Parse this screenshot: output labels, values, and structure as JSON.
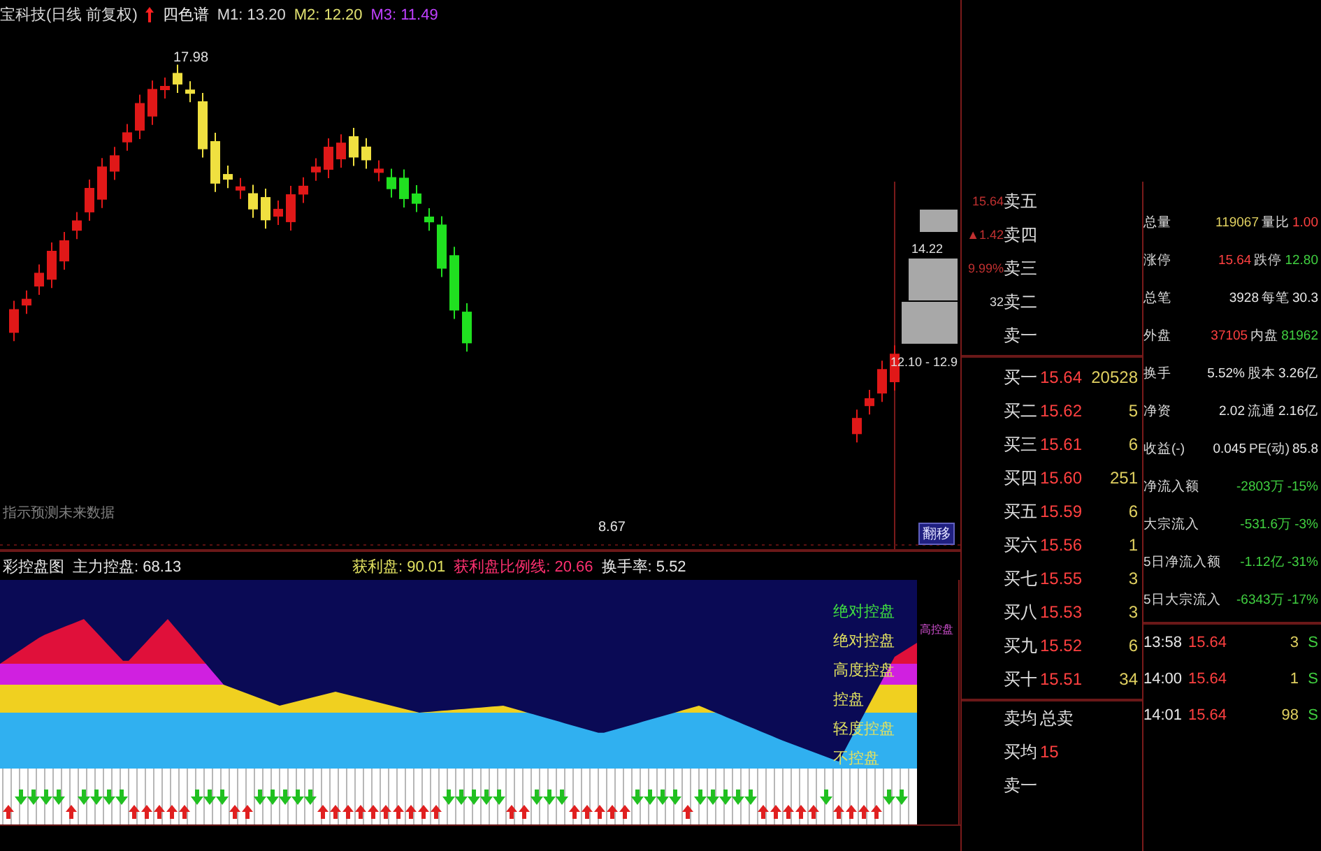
{
  "chart": {
    "title": "宝科技(日线 前复权)",
    "indicator": "四色谱",
    "ma": [
      {
        "label": "M1: 13.20",
        "color": "#d8d8d8"
      },
      {
        "label": "M2: 12.20",
        "color": "#e0e070"
      },
      {
        "label": "M3: 11.49",
        "color": "#c040ff"
      }
    ],
    "high_label": "17.98",
    "low_label": "8.67",
    "box_labels": [
      "14.22",
      "12.10 - 12.9"
    ],
    "note": "指示预测未来数据",
    "shift_button": "翻移"
  },
  "indicator": {
    "name": "彩控盘图",
    "fields_left": [
      {
        "label": "主力控盘: 68.13",
        "color": "#e8e8e8"
      }
    ],
    "fields_right": [
      {
        "label": "获利盘: 90.01",
        "color": "#e0e060"
      },
      {
        "label": "获利盘比例线: 20.66",
        "color": "#ff3070"
      },
      {
        "label": "换手率: 5.52",
        "color": "#e8e8e8"
      }
    ],
    "levels": [
      {
        "text": "绝对控盘",
        "color": "#40e040"
      },
      {
        "text": "绝对控盘",
        "color": "#e0e060"
      },
      {
        "text": "高度控盘",
        "color": "#e0e060"
      },
      {
        "text": "控盘",
        "color": "#e0e060"
      },
      {
        "text": "轻度控盘",
        "color": "#e0e060"
      },
      {
        "text": "不控盘",
        "color": "#e0e060"
      }
    ],
    "tag": "高控盘"
  },
  "order_book": {
    "sell": [
      {
        "label": "卖五",
        "axis": {
          "text": "15.64",
          "color": "#c03030"
        }
      },
      {
        "label": "卖四",
        "axis": {
          "text": "▲1.42",
          "color": "#c03030"
        }
      },
      {
        "label": "卖三",
        "axis": {
          "text": "9.99%",
          "color": "#c03030"
        }
      },
      {
        "label": "卖二",
        "axis": {
          "text": "32",
          "color": "#d8d8d8"
        }
      },
      {
        "label": "卖一"
      }
    ],
    "buy": [
      {
        "label": "买一",
        "price": "15.64",
        "volume": "20528"
      },
      {
        "label": "买二",
        "price": "15.62",
        "volume": "5"
      },
      {
        "label": "买三",
        "price": "15.61",
        "volume": "6"
      },
      {
        "label": "买四",
        "price": "15.60",
        "volume": "251"
      },
      {
        "label": "买五",
        "price": "15.59",
        "volume": "6"
      },
      {
        "label": "买六",
        "price": "15.56",
        "volume": "1"
      },
      {
        "label": "买七",
        "price": "15.55",
        "volume": "3"
      },
      {
        "label": "买八",
        "price": "15.53",
        "volume": "3"
      },
      {
        "label": "买九",
        "price": "15.52",
        "volume": "6"
      },
      {
        "label": "买十",
        "price": "15.51",
        "volume": "34"
      }
    ],
    "footer": [
      {
        "label": "卖均",
        "value": "总卖"
      },
      {
        "label": "买均",
        "value": "15"
      },
      {
        "label": "卖一"
      }
    ]
  },
  "stats": [
    [
      {
        "text": "总量",
        "color": "#d8d8d8"
      },
      {
        "text": "119067",
        "color": "#e0d060"
      },
      {
        "text": "量比",
        "color": "#d8d8d8"
      },
      {
        "text": "1.00",
        "color": "#ff4040"
      }
    ],
    [
      {
        "text": "涨停",
        "color": "#d8d8d8"
      },
      {
        "text": "15.64",
        "color": "#ff4040"
      },
      {
        "text": "跌停",
        "color": "#d8d8d8"
      },
      {
        "text": "12.80",
        "color": "#40d040"
      }
    ],
    [
      {
        "text": "总笔",
        "color": "#d8d8d8"
      },
      {
        "text": "3928",
        "color": "#e8e8e8"
      },
      {
        "text": "每笔",
        "color": "#d8d8d8"
      },
      {
        "text": "30.3",
        "color": "#e8e8e8"
      }
    ],
    [
      {
        "text": "外盘",
        "color": "#d8d8d8"
      },
      {
        "text": "37105",
        "color": "#ff4040"
      },
      {
        "text": "内盘",
        "color": "#d8d8d8"
      },
      {
        "text": "81962",
        "color": "#40d040"
      }
    ],
    [
      {
        "text": "换手",
        "color": "#d8d8d8"
      },
      {
        "text": "5.52%",
        "color": "#e8e8e8"
      },
      {
        "text": "股本",
        "color": "#d8d8d8"
      },
      {
        "text": "3.26亿",
        "color": "#e8e8e8"
      }
    ],
    [
      {
        "text": "净资",
        "color": "#d8d8d8"
      },
      {
        "text": "2.02",
        "color": "#e8e8e8"
      },
      {
        "text": "流通",
        "color": "#d8d8d8"
      },
      {
        "text": "2.16亿",
        "color": "#e8e8e8"
      }
    ],
    [
      {
        "text": "收益(-)",
        "color": "#d8d8d8"
      },
      {
        "text": "0.045",
        "color": "#e8e8e8"
      },
      {
        "text": "PE(动)",
        "color": "#d8d8d8"
      },
      {
        "text": "85.8",
        "color": "#e8e8e8"
      }
    ]
  ],
  "flows": [
    [
      {
        "text": "净流入额",
        "color": "#d8d8d8"
      },
      {
        "text": "-2803万",
        "color": "#40d040"
      },
      {
        "text": "-15%",
        "color": "#40d040"
      }
    ],
    [
      {
        "text": "大宗流入",
        "color": "#d8d8d8"
      },
      {
        "text": "-531.6万",
        "color": "#40d040"
      },
      {
        "text": "-3%",
        "color": "#40d040"
      }
    ],
    [
      {
        "text": "5日净流入额",
        "color": "#d8d8d8"
      },
      {
        "text": "-1.12亿",
        "color": "#40d040"
      },
      {
        "text": "-31%",
        "color": "#40d040"
      }
    ],
    [
      {
        "text": "5日大宗流入",
        "color": "#d8d8d8"
      },
      {
        "text": "-6343万",
        "color": "#40d040"
      },
      {
        "text": "-17%",
        "color": "#40d040"
      }
    ]
  ],
  "ticks": [
    {
      "time": "13:58",
      "price": "15.64",
      "volume": "3",
      "side": "S"
    },
    {
      "time": "14:00",
      "price": "15.64",
      "volume": "1",
      "side": "S"
    },
    {
      "time": "14:01",
      "price": "15.64",
      "volume": "98",
      "side": "S"
    }
  ]
}
